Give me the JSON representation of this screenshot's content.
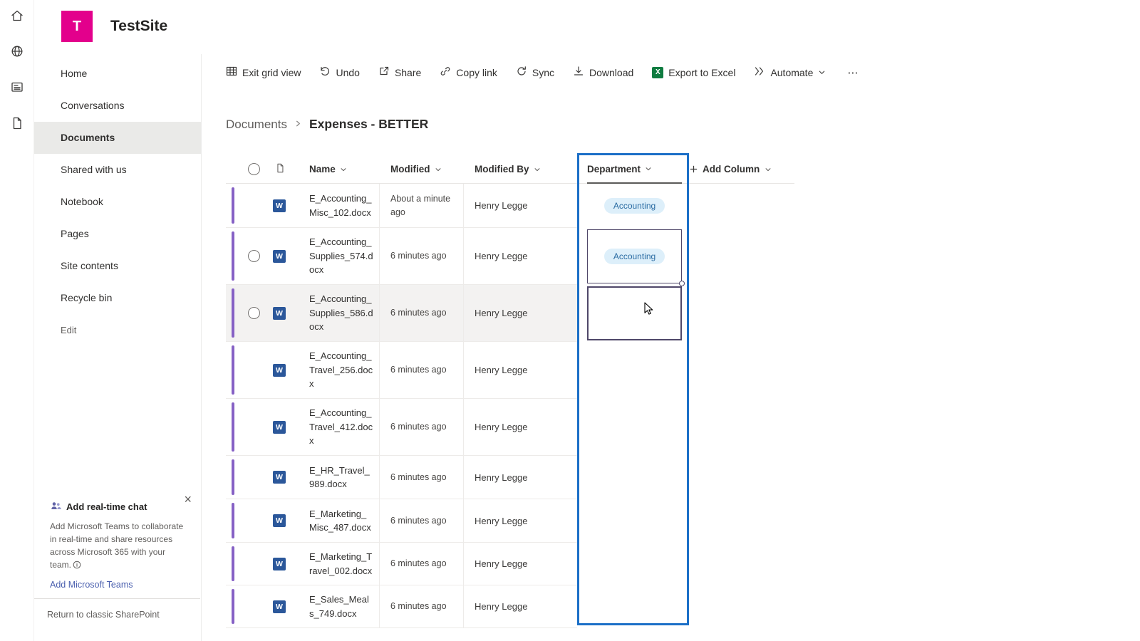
{
  "site": {
    "logo_letter": "T",
    "title": "TestSite"
  },
  "app_rail": {
    "icons": [
      "home-icon",
      "globe-icon",
      "news-icon",
      "document-icon"
    ]
  },
  "sidebar": {
    "items": [
      {
        "label": "Home",
        "selected": false
      },
      {
        "label": "Conversations",
        "selected": false
      },
      {
        "label": "Documents",
        "selected": true
      },
      {
        "label": "Shared with us",
        "selected": false
      },
      {
        "label": "Notebook",
        "selected": false
      },
      {
        "label": "Pages",
        "selected": false
      },
      {
        "label": "Site contents",
        "selected": false
      },
      {
        "label": "Recycle bin",
        "selected": false
      },
      {
        "label": "Edit",
        "selected": false
      }
    ],
    "promo": {
      "title": "Add real-time chat",
      "body_line1": "Add Microsoft Teams to collaborate in real-time and share resources across Microsoft 365 with your team.",
      "link": "Add Microsoft Teams",
      "close": "×"
    },
    "classic_link": "Return to classic SharePoint"
  },
  "toolbar": {
    "items": [
      {
        "label": "Exit grid view",
        "icon": "grid-icon"
      },
      {
        "label": "Undo",
        "icon": "undo-icon"
      },
      {
        "label": "Share",
        "icon": "share-icon"
      },
      {
        "label": "Copy link",
        "icon": "copy-link-icon"
      },
      {
        "label": "Sync",
        "icon": "sync-icon"
      },
      {
        "label": "Download",
        "icon": "download-icon"
      },
      {
        "label": "Export to Excel",
        "icon": "excel-icon"
      },
      {
        "label": "Automate",
        "icon": "automate-icon",
        "has_chevron": true
      },
      {
        "label": "⋯",
        "icon": "more-icon"
      }
    ]
  },
  "breadcrumb": {
    "parent": "Documents",
    "current": "Expenses - BETTER"
  },
  "table": {
    "columns": [
      "Name",
      "Modified",
      "Modified By",
      "Department"
    ],
    "add_column_label": "Add Column",
    "rows": [
      {
        "name": "E_Accounting_Misc_102.docx",
        "modified": "About a minute ago",
        "modified_by": "Henry Legge",
        "department": "Accounting",
        "selector_visible": false,
        "hovered": false,
        "dept_state": ""
      },
      {
        "name": "E_Accounting_Supplies_574.docx",
        "modified": "6 minutes ago",
        "modified_by": "Henry Legge",
        "department": "Accounting",
        "selector_visible": true,
        "hovered": false,
        "dept_state": "selected"
      },
      {
        "name": "E_Accounting_Supplies_586.docx",
        "modified": "6 minutes ago",
        "modified_by": "Henry Legge",
        "department": "",
        "selector_visible": true,
        "hovered": true,
        "dept_state": "active"
      },
      {
        "name": "E_Accounting_Travel_256.docx",
        "modified": "6 minutes ago",
        "modified_by": "Henry Legge",
        "department": "",
        "selector_visible": false,
        "hovered": false,
        "dept_state": ""
      },
      {
        "name": "E_Accounting_Travel_412.docx",
        "modified": "6 minutes ago",
        "modified_by": "Henry Legge",
        "department": "",
        "selector_visible": false,
        "hovered": false,
        "dept_state": ""
      },
      {
        "name": "E_HR_Travel_989.docx",
        "modified": "6 minutes ago",
        "modified_by": "Henry Legge",
        "department": "",
        "selector_visible": false,
        "hovered": false,
        "dept_state": ""
      },
      {
        "name": "E_Marketing_Misc_487.docx",
        "modified": "6 minutes ago",
        "modified_by": "Henry Legge",
        "department": "",
        "selector_visible": false,
        "hovered": false,
        "dept_state": ""
      },
      {
        "name": "E_Marketing_Travel_002.docx",
        "modified": "6 minutes ago",
        "modified_by": "Henry Legge",
        "department": "",
        "selector_visible": false,
        "hovered": false,
        "dept_state": ""
      },
      {
        "name": "E_Sales_Meals_749.docx",
        "modified": "6 minutes ago",
        "modified_by": "Henry Legge",
        "department": "",
        "selector_visible": false,
        "hovered": false,
        "dept_state": ""
      }
    ]
  },
  "icons": {
    "word_file_letter": "W",
    "excel_letter": "X"
  },
  "colors": {
    "logo_pink": "#e3008c",
    "selection_blue": "#1b6fc7",
    "edited_accent_purple": "#8661c5",
    "pill_bg": "#ddeffa",
    "pill_text": "#2b6ca3",
    "selected_item_bg": "#eaeae8"
  }
}
